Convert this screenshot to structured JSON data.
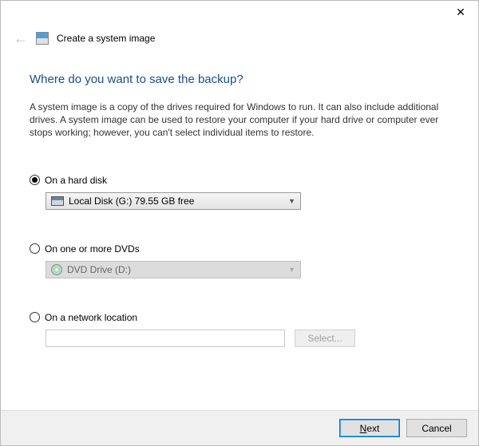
{
  "titlebar": {
    "close_glyph": "✕"
  },
  "header": {
    "back_glyph": "←",
    "wizard_title": "Create a system image"
  },
  "content": {
    "heading": "Where do you want to save the backup?",
    "description": "A system image is a copy of the drives required for Windows to run. It can also include additional drives. A system image can be used to restore your computer if your hard drive or computer ever stops working; however, you can't select individual items to restore."
  },
  "options": {
    "hard_disk": {
      "label": "On a hard disk",
      "selected_value": "Local Disk (G:)  79.55 GB free",
      "checked": true
    },
    "dvd": {
      "label": "On one or more DVDs",
      "selected_value": "DVD Drive (D:)",
      "checked": false
    },
    "network": {
      "label": "On a network location",
      "value": "",
      "select_button": "Select...",
      "checked": false
    }
  },
  "footer": {
    "next": "Next",
    "cancel": "Cancel"
  }
}
